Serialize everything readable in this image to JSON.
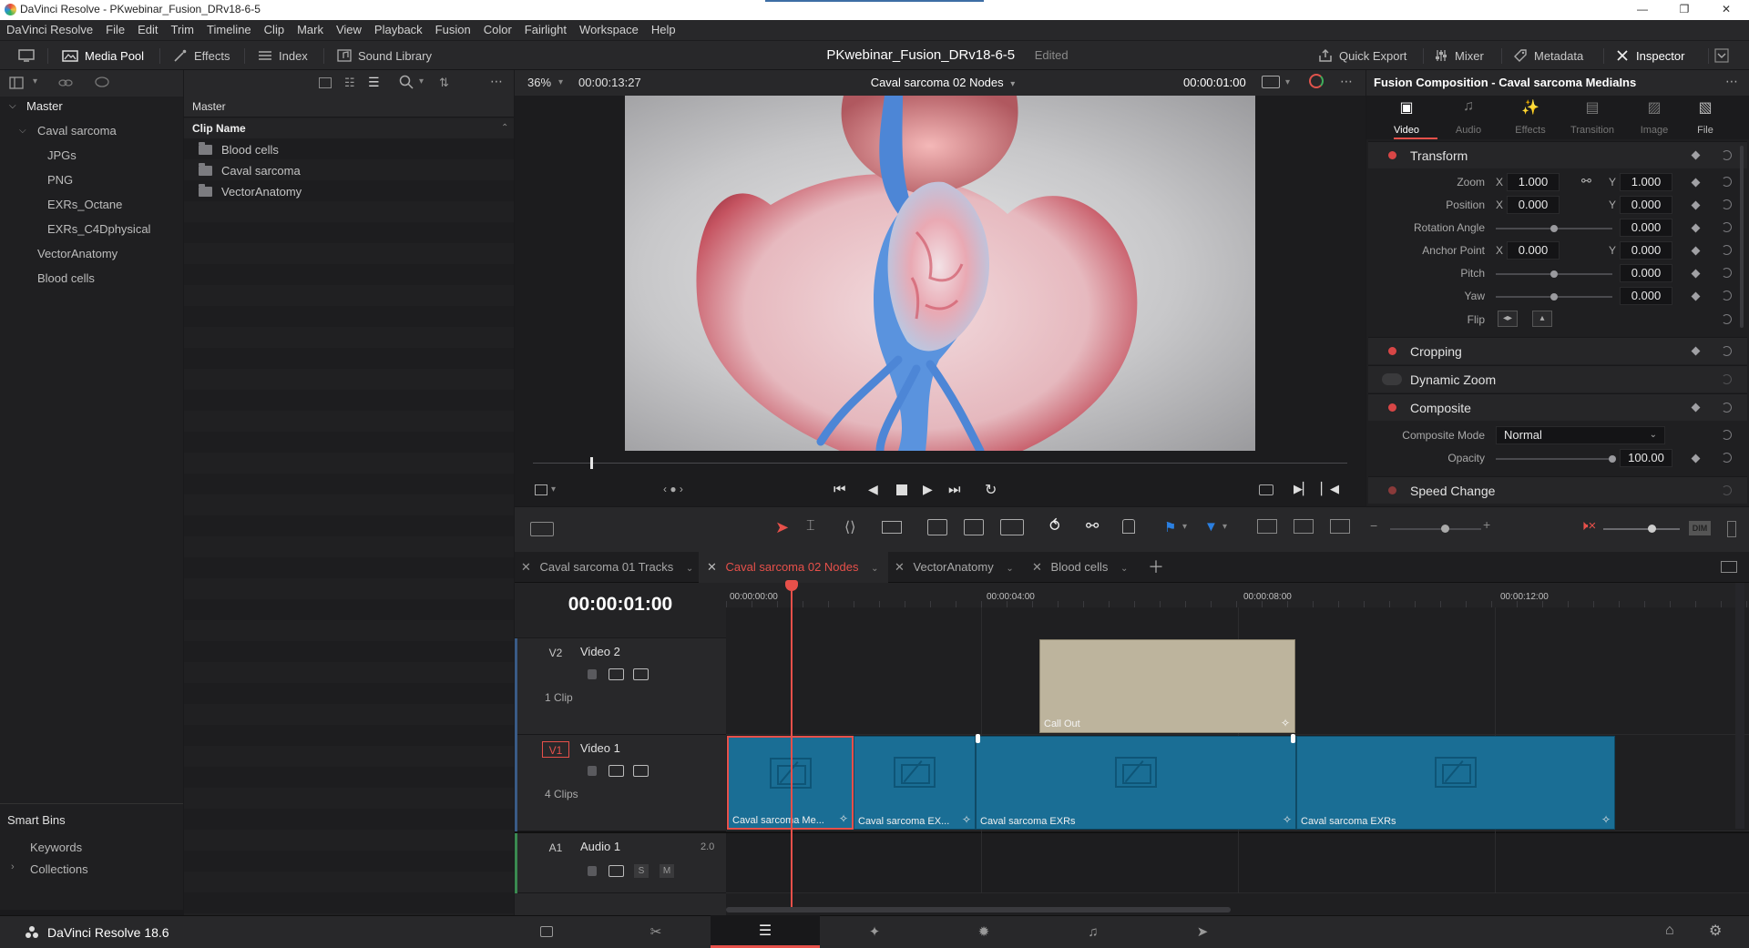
{
  "window": {
    "title": "DaVinci Resolve - PKwebinar_Fusion_DRv18-6-5"
  },
  "menu": [
    "DaVinci Resolve",
    "File",
    "Edit",
    "Trim",
    "Timeline",
    "Clip",
    "Mark",
    "View",
    "Playback",
    "Fusion",
    "Color",
    "Fairlight",
    "Workspace",
    "Help"
  ],
  "toolbar": {
    "media_pool": "Media Pool",
    "effects": "Effects",
    "index": "Index",
    "sound_library": "Sound Library",
    "project_name": "PKwebinar_Fusion_DRv18-6-5",
    "edited": "Edited",
    "quick_export": "Quick Export",
    "mixer": "Mixer",
    "metadata": "Metadata",
    "inspector": "Inspector"
  },
  "bins": {
    "root": "Master",
    "items": [
      "Caval sarcoma",
      "JPGs",
      "PNG",
      "EXRs_Octane",
      "EXRs_C4Dphysical",
      "VectorAnatomy",
      "Blood cells"
    ]
  },
  "smart_bins": {
    "title": "Smart Bins",
    "items": [
      "Keywords",
      "Collections"
    ]
  },
  "clip_list": {
    "header": "Master",
    "column": "Clip Name",
    "items": [
      "Blood cells",
      "Caval sarcoma",
      "VectorAnatomy"
    ]
  },
  "viewer": {
    "zoom": "36%",
    "duration": "00:00:13:27",
    "timeline_name": "Caval sarcoma 02 Nodes",
    "timecode": "00:00:01:00",
    "progress": 0.07
  },
  "inspector": {
    "title": "Fusion Composition - Caval sarcoma MediaIns",
    "tabs": [
      "Video",
      "Audio",
      "Effects",
      "Transition",
      "Image",
      "File"
    ],
    "transform": {
      "label": "Transform",
      "zoom_label": "Zoom",
      "zoom_x": "1.000",
      "zoom_y": "1.000",
      "position_label": "Position",
      "position_x": "0.000",
      "position_y": "0.000",
      "rotation_label": "Rotation Angle",
      "rotation": "0.000",
      "anchor_label": "Anchor Point",
      "anchor_x": "0.000",
      "anchor_y": "0.000",
      "pitch_label": "Pitch",
      "pitch": "0.000",
      "yaw_label": "Yaw",
      "yaw": "0.000",
      "flip_label": "Flip",
      "x": "X",
      "y": "Y"
    },
    "cropping": "Cropping",
    "dynamic_zoom": "Dynamic Zoom",
    "composite": {
      "label": "Composite",
      "mode_label": "Composite Mode",
      "mode": "Normal",
      "opacity_label": "Opacity",
      "opacity": "100.00"
    },
    "speed_change": "Speed Change"
  },
  "timeline_tabs": [
    "Caval sarcoma 01 Tracks",
    "Caval sarcoma 02 Nodes",
    "VectorAnatomy",
    "Blood cells"
  ],
  "timeline": {
    "timecode": "00:00:01:00",
    "ruler": [
      "00:00:00:00",
      "00:00:04:00",
      "00:00:08:00",
      "00:00:12:00"
    ],
    "tracks": [
      {
        "id": "V2",
        "name": "Video 2",
        "count": "1 Clip"
      },
      {
        "id": "V1",
        "name": "Video 1",
        "count": "4 Clips"
      },
      {
        "id": "A1",
        "name": "Audio 1",
        "channels": "2.0"
      }
    ],
    "clips_v2": [
      "Call Out"
    ],
    "clips_v1": [
      "Caval sarcoma Me...",
      "Caval sarcoma EX...",
      "Caval sarcoma EXRs",
      "Caval sarcoma EXRs"
    ],
    "audio_buttons": [
      "S",
      "M"
    ]
  },
  "footer": {
    "app": "DaVinci Resolve 18.6"
  }
}
